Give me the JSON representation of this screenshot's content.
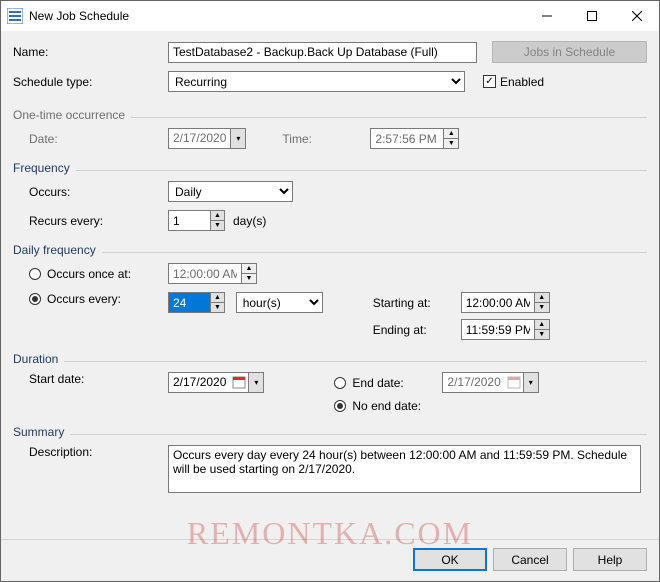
{
  "window": {
    "title": "New Job Schedule"
  },
  "labels": {
    "name": "Name:",
    "schedule_type": "Schedule type:",
    "enabled": "Enabled",
    "one_time": "One-time occurrence",
    "date": "Date:",
    "time": "Time:",
    "frequency": "Frequency",
    "occurs": "Occurs:",
    "recurs_every": "Recurs every:",
    "days": "day(s)",
    "daily_frequency": "Daily frequency",
    "occurs_once_at": "Occurs once at:",
    "occurs_every": "Occurs every:",
    "starting_at": "Starting at:",
    "ending_at": "Ending at:",
    "duration": "Duration",
    "start_date": "Start date:",
    "end_date": "End date:",
    "no_end_date": "No end date:",
    "summary": "Summary",
    "description": "Description:"
  },
  "values": {
    "name": "TestDatabase2 - Backup.Back Up Database (Full)",
    "schedule_type": "Recurring",
    "enabled": true,
    "one_time_date": "2/17/2020",
    "one_time_time": "2:57:56 PM",
    "occurs": "Daily",
    "recurs_every": "1",
    "occurs_once_time": "12:00:00 AM",
    "occurs_every_n": "24",
    "occurs_every_unit": "hour(s)",
    "starting_at": "12:00:00 AM",
    "ending_at": "11:59:59 PM",
    "start_date": "2/17/2020",
    "end_date": "2/17/2020",
    "description": "Occurs every day every 24 hour(s) between 12:00:00 AM and 11:59:59 PM. Schedule will be used starting on 2/17/2020."
  },
  "buttons": {
    "jobs_in_schedule": "Jobs in Schedule",
    "ok": "OK",
    "cancel": "Cancel",
    "help": "Help"
  },
  "watermark": "REMONTKA.COM"
}
